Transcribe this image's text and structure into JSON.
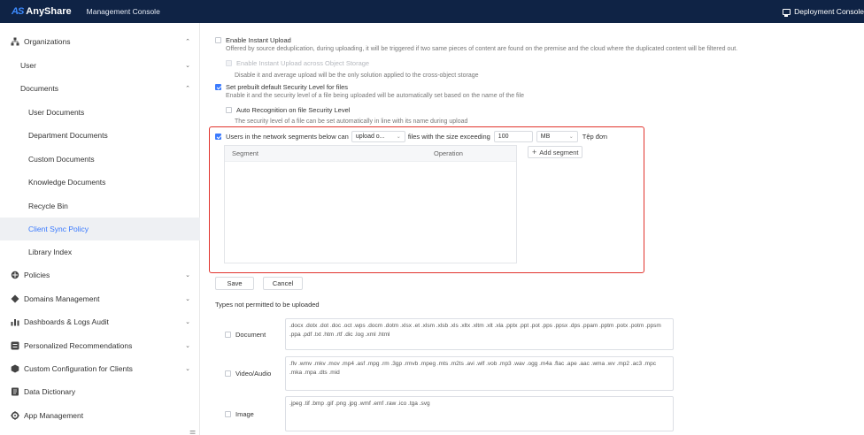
{
  "app": {
    "logo_mark": "AS",
    "logo_text": "AnyShare",
    "console_title": "Management Console",
    "deployment_console": "Deployment Console"
  },
  "sidebar": {
    "items": [
      {
        "label": "Organizations",
        "icon": "org-tree-icon",
        "level": 1,
        "expanded": true
      },
      {
        "label": "User",
        "level": 2,
        "expanded": false
      },
      {
        "label": "Documents",
        "level": 2,
        "expanded": true
      },
      {
        "label": "User Documents",
        "level": 3
      },
      {
        "label": "Department Documents",
        "level": 3
      },
      {
        "label": "Custom Documents",
        "level": 3
      },
      {
        "label": "Knowledge Documents",
        "level": 3
      },
      {
        "label": "Recycle Bin",
        "level": 3
      },
      {
        "label": "Client Sync Policy",
        "level": 3,
        "active": true
      },
      {
        "label": "Library Index",
        "level": 3
      },
      {
        "label": "Policies",
        "icon": "policy-icon",
        "level": 1
      },
      {
        "label": "Domains Management",
        "icon": "domain-icon",
        "level": 1
      },
      {
        "label": "Dashboards & Logs Audit",
        "icon": "dashboard-icon",
        "level": 1
      },
      {
        "label": "Personalized Recommendations",
        "icon": "recommend-icon",
        "level": 1
      },
      {
        "label": "Custom Configuration for Clients",
        "icon": "client-config-icon",
        "level": 1
      },
      {
        "label": "Data Dictionary",
        "icon": "dictionary-icon",
        "level": 1
      },
      {
        "label": "App Management",
        "icon": "app-gear-icon",
        "level": 1
      }
    ],
    "collapse_glyph": "☰"
  },
  "main": {
    "instant_upload": {
      "label": "Enable Instant Upload",
      "checked": false,
      "desc": "Offered by source deduplication, during uploading, it will be triggered if two same pieces of content are found on the premise and the cloud where the duplicated content will be filtered out."
    },
    "instant_upload_storage": {
      "label": "Enable Instant Upload across Object Storage",
      "disabled": true,
      "desc": "Disable it and average upload will be the only solution applied to the cross-object storage"
    },
    "prebuilt_security": {
      "label": "Set prebuilt default Security Level for files",
      "checked": true,
      "desc": "Enable it and the security level of a file being uploaded will be automatically set based on the name of the file"
    },
    "auto_recognition": {
      "label": "Auto Recognition on file Security Level",
      "checked": false,
      "desc": "The security level of a file can be set automatically in line with its name during upload"
    },
    "network_segment": {
      "label": "Users in the network segments below can",
      "checked": true,
      "action_select": "upload o...",
      "size_text": "files with the size exceeding",
      "size_value": "100",
      "unit_select": "MB",
      "tail_text": "Tệp đơn",
      "table_headers": {
        "segment": "Segment",
        "operation": "Operation"
      },
      "add_segment": "Add segment"
    },
    "buttons": {
      "save": "Save",
      "cancel": "Cancel"
    },
    "types_title": "Types not permitted to be uploaded",
    "types": [
      {
        "label": "Document",
        "checked": false,
        "extensions": ".docx .dotx .dot .doc .oct .wps .docm .dotm .xlsx .et .xlsm .xlsb .xls .xltx .xltm .xlt .xla .pptx .ppt .pot .pps .ppsx .dps .ppam .pptm .potx .potm .ppsm .ppa .pdf .txt .htm .rtf .dic .log .xml .html"
      },
      {
        "label": "Video/Audio",
        "checked": false,
        "extensions": ".flv .wmv .mkv .mov .mp4 .asf .mpg .rm .3gp .rmvb .mpeg .mts .m2ts .avi .wlf .vob .mp3 .wav .ogg .m4a .flac .ape .aac .wma .wv .mp2 .ac3 .mpc .mka .mpa .dts .mid"
      },
      {
        "label": "Image",
        "checked": false,
        "extensions": ".jpeg .tif .bmp .gif .png .jpg .wmf .emf .raw .ico .tga .svg"
      }
    ]
  },
  "colors": {
    "topbar": "#0f2345",
    "accent": "#3a7afe",
    "highlight_border": "#e1342d",
    "active_bg": "#eef0f3"
  }
}
